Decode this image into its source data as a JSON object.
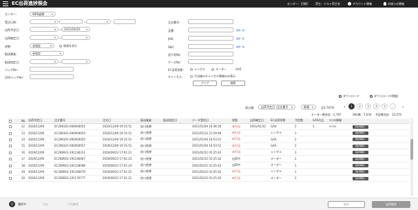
{
  "header": {
    "title": "EC出荷進捗照会",
    "center": "センター：目黒C",
    "owner": "荷主：テスト荷主名",
    "account": "アカウント情報",
    "notice": "お知らせ情報"
  },
  "form": {
    "center_label": "センター：",
    "center_value": "WEB倉庫",
    "order_date_label": "受注日時：",
    "ship_plan_label": "出荷予定日：",
    "ship_plan_value": "2021/04/20",
    "ship_confirm_label": "出荷確定日：",
    "status_label": "状態：",
    "status_value": "未指定",
    "backorder_label": "過発を含む",
    "carrier_label": "配送業者：",
    "carrier_value": "未指定",
    "delivery_date_label": "配送指定日：",
    "batch_label": "バッチNo：",
    "gas_batch_label": "GASバッチNo：",
    "order_no_label": "注文番号：",
    "item_label": "品番：",
    "jan_label": "JAN：",
    "sku_label": "SKU：",
    "tracking_label": "送り状No：",
    "case_label": "ケースNo：",
    "ec_type_label": "EC出荷形態：",
    "ec_types": [
      "シングル",
      "オーダー",
      "GAS"
    ],
    "cancel_label": "キャンセル：",
    "cancel_option": "引当後のキャンセル情報のみ表示",
    "multi_link": "複数一括",
    "clear_button": "クリア",
    "search_button": "検索"
  },
  "downloads": {
    "download": "ダウンロード",
    "download_detail": "ダウンロード(明細)"
  },
  "listbar": {
    "display_order_label": "表示順：",
    "display_order_value": "出荷予定日→注文番号",
    "direction_value": "昇順",
    "total_label": "全5,797件",
    "pages": [
      "1",
      "2",
      "3",
      "4",
      "5",
      "..."
    ],
    "order_total": "オーダー数合計：5,797",
    "sku_total": "SKU数：5,030",
    "plan_total": "予定数合計：15,070"
  },
  "table": {
    "headers": [
      "No",
      "出荷予定日",
      "注文番号",
      "注文日",
      "配送業者",
      "配送指定日",
      "データ受信日",
      "状態",
      "出荷確定日",
      "EC出荷形態",
      "予定数",
      "GAS方品",
      "ｷｬﾝｾﾙ情報",
      ""
    ],
    "rows": [
      [
        "12",
        "2020/12/09",
        "EC208101-000000052",
        "2020/12/09 19:15:51",
        "佐川急便",
        "",
        "2021/01/04 16:36:56",
        "未引当",
        "2021/01/12",
        "GAS",
        "2",
        "1",
        "ｷｬﾝｾﾙ",
        "検討明細へ"
      ],
      [
        "13",
        "2020/12/09",
        "EC208101-000000054",
        "2020/12/09 19:15:51",
        "佐川急便",
        "",
        "2021/01/12 21:59:49",
        "未引当",
        "",
        "シングル",
        "1",
        "",
        "",
        "検討明細へ"
      ],
      [
        "14",
        "2020/12/09",
        "EC208101-000000055",
        "2020/12/09 19:15:51",
        "佐川急便",
        "",
        "2021/01/04 16:53:51",
        "未引当",
        "",
        "GAS",
        "2",
        "",
        "",
        "検討明細へ"
      ],
      [
        "15",
        "2020/12/09",
        "EC208101-000000057",
        "2020/12/09 19:15:51",
        "佐川急便",
        "",
        "2021/01/04 16:53:51",
        "未引当",
        "",
        "GAS",
        "2",
        "",
        "",
        "検討明細へ"
      ],
      [
        "16",
        "2020/12/09",
        "EC208923-191136311",
        "2020/09/23 17:01:21",
        "佐川急便",
        "",
        "2021/02/22 01:25:42",
        "未引当",
        "",
        "シングル",
        "1",
        "",
        "",
        "検討明細へ"
      ],
      [
        "17",
        "2020/12/09",
        "EC208923-191146487",
        "2020/09/23 17:01:23",
        "佐川急便",
        "",
        "2021/02/22 01:25:42",
        "出荷中",
        "",
        "オーダー",
        "2",
        "",
        "",
        "検討明細へ"
      ],
      [
        "18",
        "2020/12/09",
        "EC208923-191158588",
        "2020/09/23 17:01:24",
        "佐川急便",
        "",
        "2021/02/22 01:25:42",
        "出荷中",
        "",
        "オーダー",
        "1",
        "",
        "",
        "検討明細へ"
      ],
      [
        "19",
        "2020/12/09",
        "EC208923-191166679",
        "2020/09/23 17:01:21",
        "佐川急便",
        "",
        "2021/02/22 01:25:42",
        "未引当",
        "",
        "シングル",
        "1",
        "",
        "",
        "検討明細へ"
      ],
      [
        "20",
        "2020/12/09",
        "EC208923-191176777",
        "2020/09/23 17:01:21",
        "佐川急便",
        "",
        "2021/02/22 01:25:42",
        "未引当",
        "",
        "オーダー",
        "2",
        "",
        "",
        "検討明細へ"
      ]
    ]
  },
  "footer": {
    "selected_count": "0",
    "selected_label": "選択中",
    "action1": "引当",
    "action2": "引当解除",
    "back_button": "戻る",
    "confirm_button": "出荷確定"
  }
}
